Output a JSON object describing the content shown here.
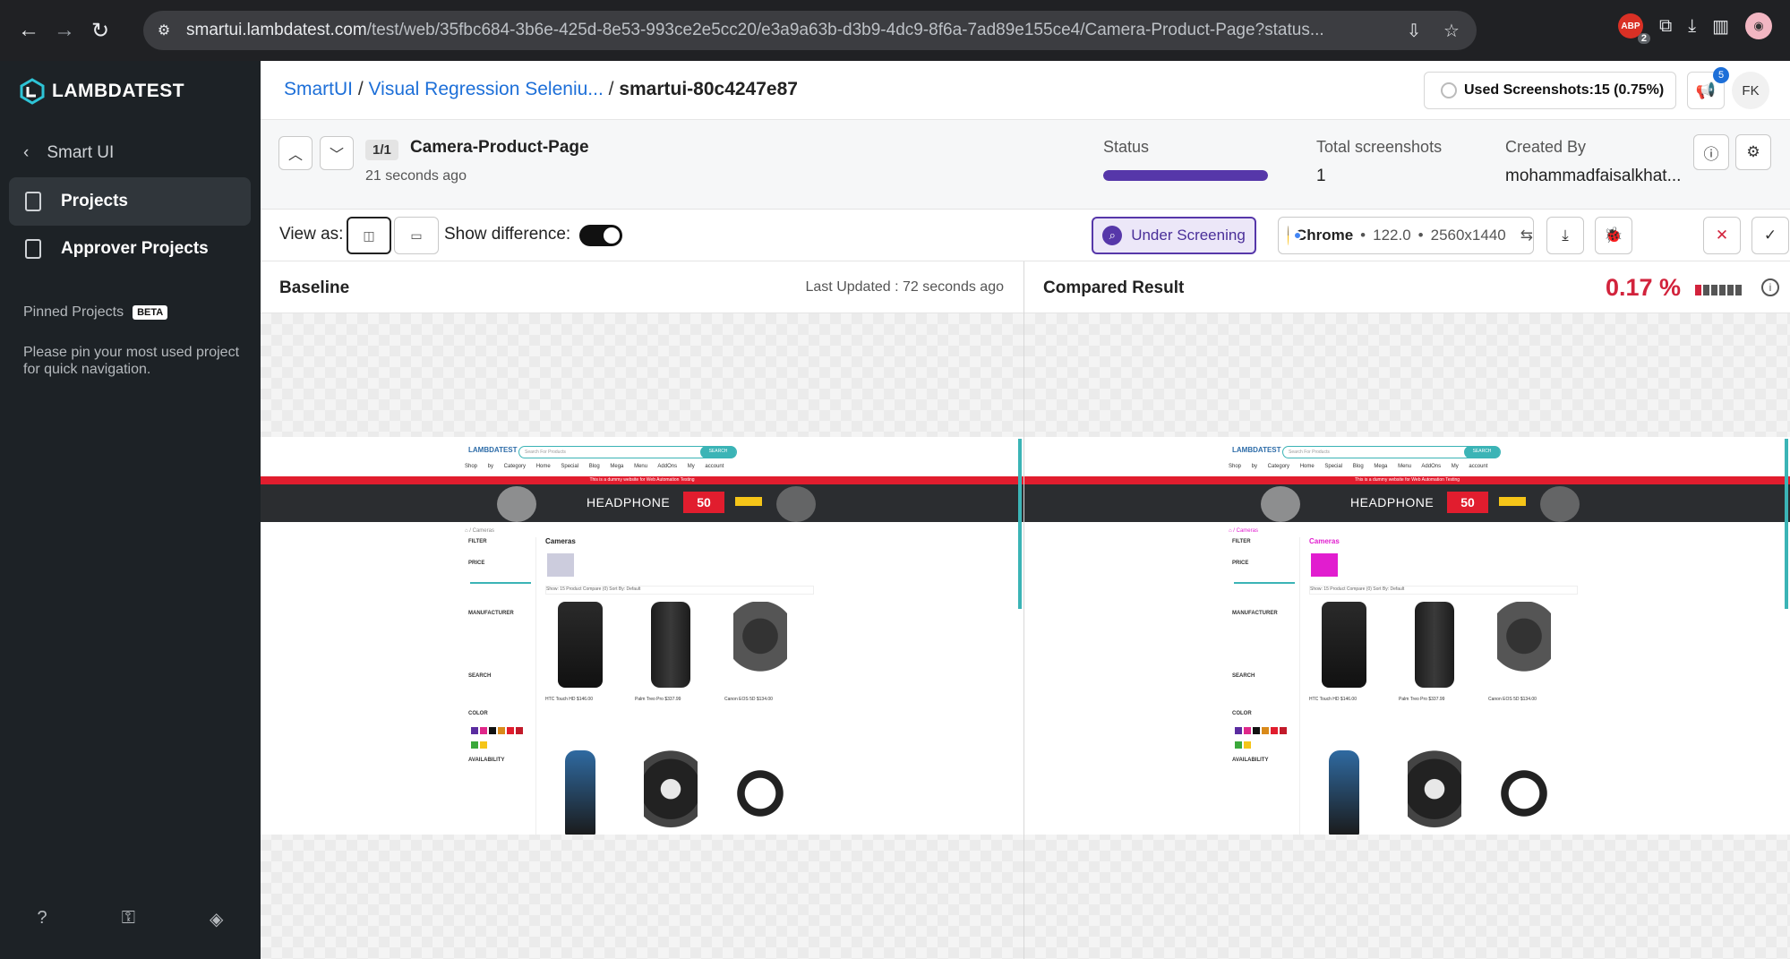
{
  "browser": {
    "url_host": "smartui.lambdatest.com",
    "url_path": "/test/web/35fbc684-3b6e-425d-8e53-993ce2e5cc20/e3a9a63b-d3b9-4dc9-8f6a-7ad89e155ce4/Camera-Product-Page?status...",
    "ext_badge": "2"
  },
  "sidebar": {
    "logo": "LAMBDATEST",
    "back_label": "Smart UI",
    "items": [
      {
        "label": "Projects"
      },
      {
        "label": "Approver Projects"
      }
    ],
    "pinned_title": "Pinned Projects",
    "beta": "BETA",
    "pinned_msg": "Please pin your most used project for quick navigation."
  },
  "header": {
    "crumb_root": "SmartUI",
    "crumb_sep": " / ",
    "crumb_project": "Visual Regression Seleniu...",
    "crumb_build": "smartui-80c4247e87",
    "used_screenshots": "Used Screenshots:15 (0.75%)",
    "notif_count": "5",
    "avatar": "FK"
  },
  "info": {
    "counter": "1/1",
    "page_name": "Camera-Product-Page",
    "time": "21 seconds ago",
    "status_label": "Status",
    "status_progress": 1.0,
    "total_label": "Total screenshots",
    "total_value": "1",
    "created_label": "Created By",
    "created_value": "mohammadfaisalkhat..."
  },
  "toolbar": {
    "view_as": "View as:",
    "show_diff": "Show difference:",
    "screening": "Under Screening",
    "browser_name": "Chrome",
    "version": "122.0",
    "resolution": "2560x1440",
    "dot": "•"
  },
  "baseline": {
    "title": "Baseline",
    "updated": "Last Updated : 72 seconds ago"
  },
  "compared": {
    "title": "Compared Result",
    "mismatch": "0.17 %"
  },
  "shot": {
    "logo": "LAMBDATEST",
    "search_placeholder": "Search For Products",
    "search_btn": "SEARCH",
    "nav": "Shop by Category Home Special Blog Mega Menu AddOns My account",
    "promo": "This is a dummy website for Web Automation Testing",
    "banner_title": "HEADPHONE",
    "banner_offer": "50",
    "crumb": "⌂ / Cameras",
    "filter": "FILTER",
    "price": "PRICE",
    "manufacturer": "MANUFACTURER",
    "search": "SEARCH",
    "color": "COLOR",
    "availability": "AVAILABILITY",
    "category": "Cameras",
    "sort": "Show: 15   Product Compare (0)   Sort By: Default",
    "products": [
      {
        "name": "HTC Touch HD",
        "price": "$146.00"
      },
      {
        "name": "Palm Treo Pro",
        "price": "$337.99"
      },
      {
        "name": "Canon EOS 5D",
        "price": "$134.00"
      }
    ]
  }
}
